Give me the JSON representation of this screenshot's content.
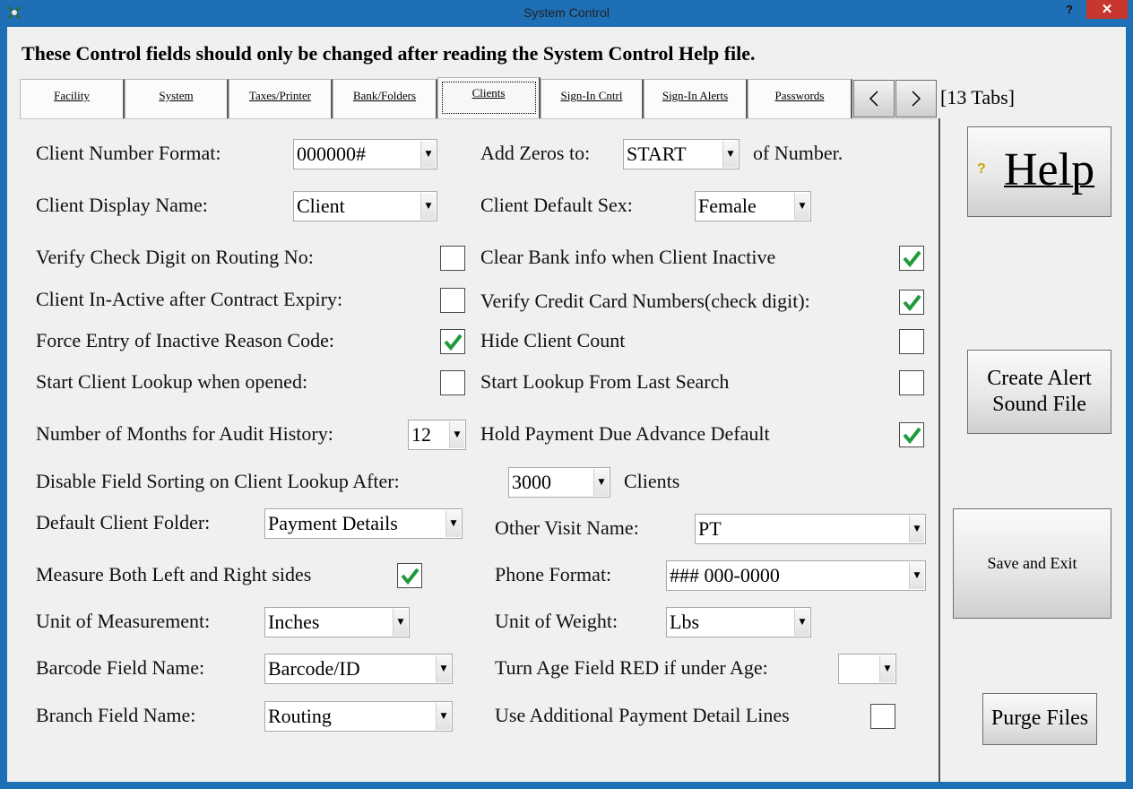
{
  "window": {
    "title": "System Control",
    "help_glyph": "?",
    "close_glyph": "✕"
  },
  "header": {
    "warning": "These Control fields should only be changed after reading the System Control Help file."
  },
  "tabs": [
    {
      "label": "Facility"
    },
    {
      "label": "System"
    },
    {
      "label": "Taxes/Printer"
    },
    {
      "label": "Bank/Folders"
    },
    {
      "label": "Clients",
      "active": true
    },
    {
      "label": "Sign-In Cntrl"
    },
    {
      "label": "Sign-In Alerts"
    },
    {
      "label": "Passwords"
    }
  ],
  "tab_count": "[13 Tabs]",
  "form": {
    "client_number_format": {
      "label": "Client Number Format:",
      "value": "000000#"
    },
    "add_zeros_to": {
      "label": "Add Zeros to:",
      "value": "START",
      "suffix": "of Number."
    },
    "client_display_name": {
      "label": "Client Display Name:",
      "value": "Client"
    },
    "client_default_sex": {
      "label": "Client Default Sex:",
      "value": "Female"
    },
    "verify_check_digit": {
      "label": "Verify Check Digit on Routing No:",
      "checked": false
    },
    "clear_bank_info": {
      "label": "Clear Bank info when Client Inactive",
      "checked": true
    },
    "inactive_after_expiry": {
      "label": "Client In-Active after Contract Expiry:",
      "checked": false
    },
    "verify_credit_card": {
      "label": "Verify Credit Card Numbers(check digit):",
      "checked": true
    },
    "force_inactive_reason": {
      "label": "Force Entry of Inactive Reason Code:",
      "checked": true
    },
    "hide_client_count": {
      "label": "Hide Client Count",
      "checked": false
    },
    "start_lookup_opened": {
      "label": "Start Client Lookup when opened:",
      "checked": false
    },
    "start_lookup_last": {
      "label": "Start Lookup From Last Search",
      "checked": false
    },
    "audit_history_months": {
      "label": "Number of Months for Audit History:",
      "value": "12"
    },
    "hold_payment_due": {
      "label": "Hold Payment Due Advance Default",
      "checked": true
    },
    "disable_sorting_after": {
      "label": "Disable Field Sorting on Client Lookup After:",
      "value": "3000",
      "suffix": "Clients"
    },
    "default_client_folder": {
      "label": "Default Client Folder:",
      "value": "Payment Details"
    },
    "other_visit_name": {
      "label": "Other Visit Name:",
      "value": "PT"
    },
    "measure_both_sides": {
      "label": "Measure Both Left and Right sides",
      "checked": true
    },
    "phone_format": {
      "label": "Phone Format:",
      "value": "### 000-0000"
    },
    "unit_measurement": {
      "label": "Unit of Measurement:",
      "value": "Inches"
    },
    "unit_weight": {
      "label": "Unit of Weight:",
      "value": "Lbs"
    },
    "barcode_field": {
      "label": "Barcode Field Name:",
      "value": "Barcode/ID"
    },
    "age_red_under": {
      "label": "Turn Age Field RED if under Age:",
      "value": ""
    },
    "branch_field": {
      "label": "Branch Field Name:",
      "value": "Routing"
    },
    "additional_payment_lines": {
      "label": "Use Additional Payment Detail Lines",
      "checked": false
    }
  },
  "buttons": {
    "help": {
      "label": "Help",
      "icon": "?"
    },
    "create_alert_line1": "Create Alert",
    "create_alert_line2": "Sound File",
    "save_exit": "Save and Exit",
    "purge": "Purge Files"
  },
  "colors": {
    "titlebar": "#1e6fb5",
    "close": "#c7372f",
    "check": "#1f9a3a"
  }
}
